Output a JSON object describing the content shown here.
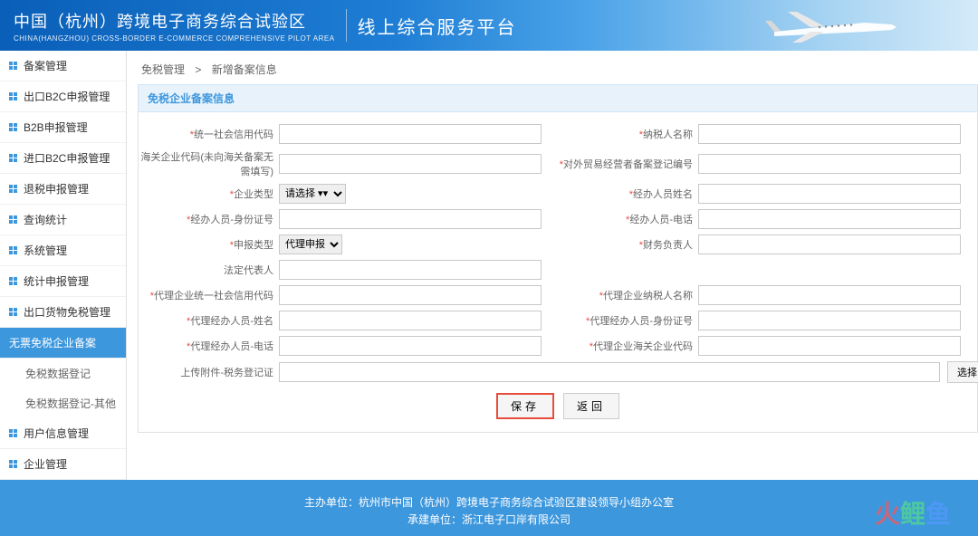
{
  "header": {
    "title": "中国（杭州）跨境电子商务综合试验区",
    "subtitle": "CHINA(HANGZHOU) CROSS-BORDER E-COMMERCE COMPREHENSIVE PILOT AREA",
    "platform": "线上综合服务平台"
  },
  "sidebar": {
    "items": [
      {
        "label": "备案管理"
      },
      {
        "label": "出口B2C申报管理"
      },
      {
        "label": "B2B申报管理"
      },
      {
        "label": "进口B2C申报管理"
      },
      {
        "label": "退税申报管理"
      },
      {
        "label": "查询统计"
      },
      {
        "label": "系统管理"
      },
      {
        "label": "统计申报管理"
      },
      {
        "label": "出口货物免税管理"
      }
    ],
    "active_item": "无票免税企业备案",
    "sub_items": [
      {
        "label": "免税数据登记"
      },
      {
        "label": "免税数据登记-其他"
      }
    ],
    "bottom_items": [
      {
        "label": "用户信息管理"
      },
      {
        "label": "企业管理"
      }
    ]
  },
  "breadcrumb": {
    "parent": "免税管理",
    "sep": ">",
    "current": "新增备案信息"
  },
  "section_title": "免税企业备案信息",
  "form": {
    "unified_code": {
      "label": "统一社会信用代码",
      "required": true
    },
    "taxpayer_name": {
      "label": "纳税人名称",
      "required": true
    },
    "customs_code": {
      "label": "海关企业代码(未向海关备案无需填写)",
      "required": false
    },
    "foreign_trade_reg": {
      "label": "对外贸易经营者备案登记编号",
      "required": true
    },
    "enterprise_type": {
      "label": "企业类型",
      "required": true,
      "placeholder": "请选择 ▾▾"
    },
    "operator_name": {
      "label": "经办人员姓名",
      "required": true
    },
    "operator_id": {
      "label": "经办人员-身份证号",
      "required": true
    },
    "operator_phone": {
      "label": "经办人员-电话",
      "required": true
    },
    "declare_type": {
      "label": "申报类型",
      "required": true,
      "value": "代理申报"
    },
    "finance_person": {
      "label": "财务负责人",
      "required": true
    },
    "legal_rep": {
      "label": "法定代表人",
      "required": false
    },
    "agent_unified_code": {
      "label": "代理企业统一社会信用代码",
      "required": true
    },
    "agent_taxpayer_name": {
      "label": "代理企业纳税人名称",
      "required": true
    },
    "agent_operator_name": {
      "label": "代理经办人员-姓名",
      "required": true
    },
    "agent_operator_id": {
      "label": "代理经办人员-身份证号",
      "required": true
    },
    "agent_operator_phone": {
      "label": "代理经办人员-电话",
      "required": true
    },
    "agent_customs_code": {
      "label": "代理企业海关企业代码",
      "required": true
    },
    "upload_attachment": {
      "label": "上传附件-税务登记证",
      "required": false
    }
  },
  "buttons": {
    "save": "保存",
    "back": "返回",
    "choose": "选择"
  },
  "footer": {
    "line1_label": "主办单位：",
    "line1_value": "杭州市中国（杭州）跨境电子商务综合试验区建设领导小组办公室",
    "line2_label": "承建单位：",
    "line2_value": "浙江电子口岸有限公司"
  },
  "watermark": "火鲤鱼"
}
